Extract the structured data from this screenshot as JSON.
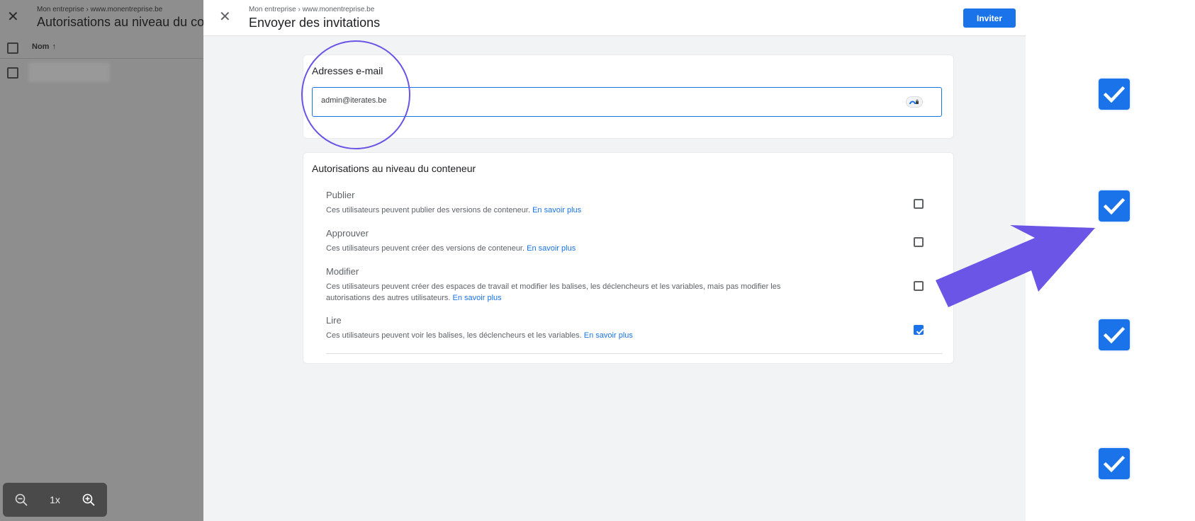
{
  "background": {
    "breadcrumb": "Mon entreprise › www.monentreprise.be",
    "title": "Autorisations au niveau du conteneur",
    "column_header": "Nom",
    "sort_arrow": "↑",
    "zoom_level": "1x",
    "icons": [
      "close-icon",
      "zoom-out-icon",
      "zoom-in-icon"
    ]
  },
  "dialog": {
    "breadcrumb": "Mon entreprise › www.monentreprise.be",
    "title": "Envoyer des invitations",
    "invite_label": "Inviter",
    "email_section": {
      "title": "Adresses e-mail",
      "value": "admin@iterates.be"
    },
    "permissions_section": {
      "title": "Autorisations au niveau du conteneur",
      "link_text": "En savoir plus",
      "items": [
        {
          "name": "Publier",
          "desc": "Ces utilisateurs peuvent publier des versions de conteneur.",
          "checked": false
        },
        {
          "name": "Approuver",
          "desc": "Ces utilisateurs peuvent créer des versions de conteneur.",
          "checked": false
        },
        {
          "name": "Modifier",
          "desc": "Ces utilisateurs peuvent créer des espaces de travail et modifier les balises, les déclencheurs et les variables, mais pas modifier les autorisations des autres utilisateurs.",
          "checked": false
        },
        {
          "name": "Lire",
          "desc": "Ces utilisateurs peuvent voir les balises, les déclencheurs et les variables.",
          "checked": true
        }
      ]
    }
  },
  "colors": {
    "accent": "#1a73e8",
    "annotation": "#6b55e6",
    "overlay": "#8e8e8e"
  }
}
